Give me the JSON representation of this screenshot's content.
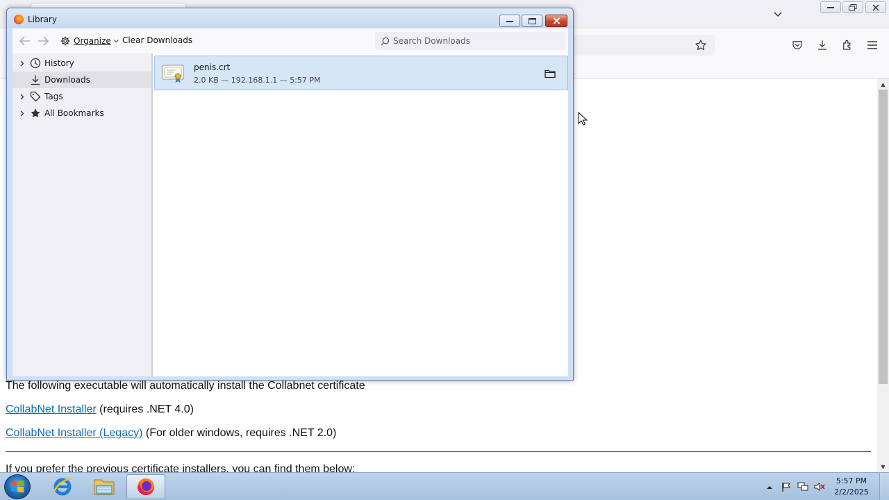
{
  "library": {
    "title": "Library",
    "toolbar": {
      "organize_label": "Organize",
      "clear_downloads_label": "Clear Downloads",
      "search_placeholder": "Search Downloads"
    },
    "sidebar": {
      "items": [
        {
          "label": "History",
          "icon": "clock-icon",
          "expandable": true
        },
        {
          "label": "Downloads",
          "icon": "download-icon",
          "expandable": false,
          "selected": true
        },
        {
          "label": "Tags",
          "icon": "tag-icon",
          "expandable": true
        },
        {
          "label": "All Bookmarks",
          "icon": "star-icon",
          "expandable": true
        }
      ]
    },
    "downloads": [
      {
        "name": "penis.crt",
        "details": "2.0 KB — 192.168.1.1 — 5:57 PM",
        "icon": "certificate-file-icon"
      }
    ]
  },
  "page": {
    "line1": "The following executable will automatically install the Collabnet certificate",
    "installer_link": "CollabNet Installer",
    "installer_note": " (requires .NET 4.0)",
    "legacy_link": "CollabNet Installer (Legacy)",
    "legacy_note": " (For older windows, requires .NET 2.0)",
    "line_previous": "If you prefer the previous certificate installers, you can find them below:"
  },
  "taskbar": {
    "clock_time": "5:57 PM",
    "clock_date": "2/2/2025",
    "apps": [
      "internet-explorer-icon",
      "file-explorer-icon",
      "firefox-icon"
    ]
  },
  "colors": {
    "link": "#0b6fb8",
    "selection": "#d6e6f7",
    "library_frame": "#cfe0f5",
    "taskbar": "#a7c1de"
  }
}
